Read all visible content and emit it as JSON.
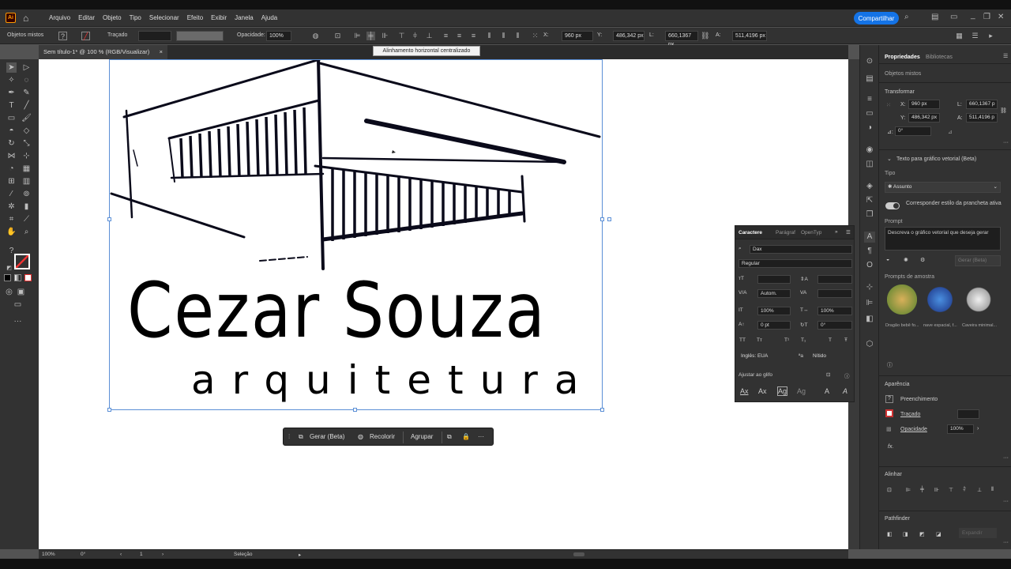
{
  "app": {
    "logo": "Ai",
    "home_icon": "home-icon"
  },
  "menu": [
    "Arquivo",
    "Editar",
    "Objeto",
    "Tipo",
    "Selecionar",
    "Efeito",
    "Exibir",
    "Janela",
    "Ajuda"
  ],
  "share_label": "Compartilhar",
  "control": {
    "mixed_objects": "Objetos mistos",
    "stroke_label": "Traçado",
    "opacity_label": "Opacidade:",
    "opacity_value": "100%",
    "x_label": "X:",
    "x_value": "960 px",
    "y_label": "Y:",
    "y_value": "486,342 px",
    "w_label": "L:",
    "w_value": "660,1367 px",
    "h_label": "A:",
    "h_value": "511,4196 px"
  },
  "tooltip": "Alinhamento horizontal centralizado",
  "document_tab": {
    "title": "Sem título-1* @ 100 % (RGB/Visualizar)",
    "close": "×"
  },
  "artwork": {
    "name_text": "Cezar Souza",
    "subtitle_text": "arquitetura"
  },
  "context_bar": {
    "generate": "Gerar (Beta)",
    "recolor": "Recolorir",
    "group": "Agrupar"
  },
  "status": {
    "zoom": "100%",
    "rotation": "0°",
    "artboard": "1",
    "tool": "Seleção"
  },
  "properties": {
    "tab_properties": "Propriedades",
    "tab_libraries": "Bibliotecas",
    "mixed_objects": "Objetos mistos",
    "transform_title": "Transformar",
    "x_label": "X:",
    "x_value": "960 px",
    "y_label": "Y:",
    "y_value": "486,342 px",
    "w_label": "L:",
    "w_value": "660,1367 p",
    "h_label": "A:",
    "h_value": "511,4196 p",
    "angle_label": "⊿:",
    "angle_value": "0°",
    "text_to_vector": "Texto para gráfico vetorial (Beta)",
    "type_label": "Tipo",
    "type_value": "Assunto",
    "match_style": "Corresponder estilo da prancheta ativa",
    "prompt_label": "Prompt",
    "prompt_placeholder": "Descreva o gráfico vetorial que deseja gerar",
    "generate_button": "Gerar (Beta)",
    "sample_prompts_title": "Prompts de amostra",
    "samples": [
      "Dragão bebê fo...",
      "nave espacial, f...",
      "Caveira minimal..."
    ],
    "appearance_title": "Aparência",
    "fill_label": "Preenchimento",
    "stroke_label": "Traçado",
    "opacity_label": "Opacidade",
    "opacity_value": "100%",
    "fx_label": "fx.",
    "align_title": "Alinhar",
    "pathfinder_title": "Pathfinder",
    "expand_label": "Expandir"
  },
  "character": {
    "tab_character": "Caractere",
    "tab_paragraph": "Parágraf",
    "tab_opentype": "OpenTyp",
    "font_family": "Dax",
    "font_style": "Regular",
    "leading": "Autom.",
    "vscale": "100%",
    "hscale": "100%",
    "baseline": "0 pt",
    "rotation": "0°",
    "language": "Inglês: EUA",
    "aa_label": "ªa",
    "antialias": "Nítido",
    "snap_label": "Ajustar ao glifo"
  }
}
